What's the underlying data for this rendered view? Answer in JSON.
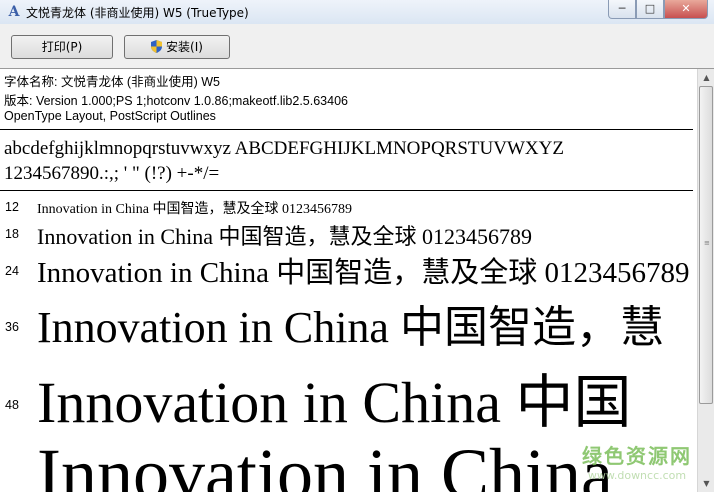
{
  "window": {
    "title": "文悦青龙体 (非商业使用) W5 (TrueType)",
    "controls": {
      "minimize": "─",
      "maximize": "□",
      "close": "✕"
    }
  },
  "toolbar": {
    "print_label": "打印(P)",
    "install_label": "安装(I)"
  },
  "info": {
    "font_name_line": "字体名称: 文悦青龙体 (非商业使用) W5",
    "version_line": "版本: Version 1.000;PS 1;hotconv 1.0.86;makeotf.lib2.5.63406",
    "tech_line": "OpenType Layout, PostScript Outlines"
  },
  "charset": {
    "letters": "abcdefghijklmnopqrstuvwxyz ABCDEFGHIJKLMNOPQRSTUVWXYZ",
    "digits_symbols": "1234567890.:,; ' \" (!?) +-*/="
  },
  "samples": [
    {
      "size": "12",
      "latin": "Innovation in China ",
      "cjk": "中国智造，慧及全球",
      "tail": " 0123456789"
    },
    {
      "size": "18",
      "latin": "Innovation in China ",
      "cjk": "中国智造，慧及全球",
      "tail": " 0123456789"
    },
    {
      "size": "24",
      "latin": "Innovation in China ",
      "cjk": "中国智造，慧及全球",
      "tail": " 0123456789"
    },
    {
      "size": "36",
      "latin": "Innovation in China ",
      "cjk": "中国智造，慧",
      "tail": ""
    },
    {
      "size": "48",
      "latin": "Innovation in China ",
      "cjk": "中国",
      "tail": ""
    },
    {
      "size": "",
      "latin": "Innovation in China",
      "cjk": "",
      "tail": ""
    }
  ],
  "icons": {
    "app": "font-viewer-icon",
    "install": "uac-shield-icon"
  },
  "watermark": {
    "main": "绿色资源网",
    "url": "www.downcc.com"
  },
  "colors": {
    "titlebar": "#dbe6f3",
    "close_button": "#c75050",
    "watermark": "#7cbf5b"
  }
}
